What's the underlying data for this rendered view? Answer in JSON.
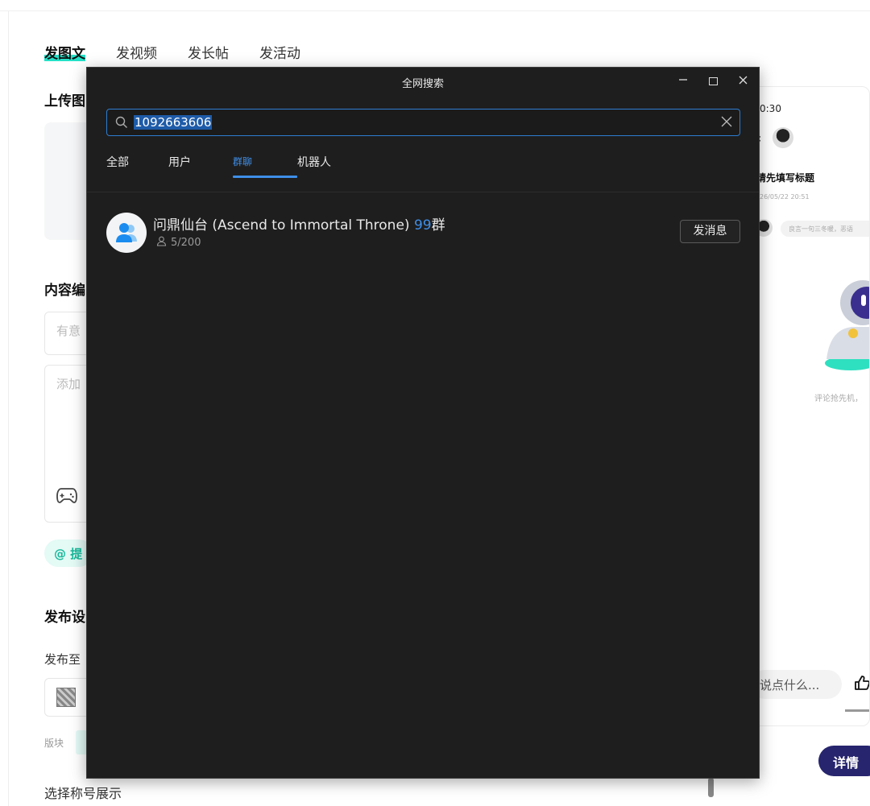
{
  "editor": {
    "tabs": [
      {
        "label": "发图文",
        "active": true
      },
      {
        "label": "发视频",
        "active": false
      },
      {
        "label": "发长帖",
        "active": false
      },
      {
        "label": "发活动",
        "active": false
      }
    ],
    "upload_title": "上传图",
    "content_title": "内容编",
    "title_placeholder": "有意",
    "body_placeholder": "添加",
    "mention_label": "@ 提",
    "publish_title": "发布设",
    "publish_to_label": "发布至",
    "board_label": "版块",
    "badge_label": "选择称号展示"
  },
  "preview": {
    "time": "0:30",
    "back_glyph": "‹",
    "post_title": "请先填写标题",
    "date": "26/05/22 20:51",
    "comment_snippet": "良言一句三冬暖，恶语",
    "empty_tip": "评论抢先机，",
    "say_placeholder": "说点什么...",
    "detail_label": "详情"
  },
  "dialog": {
    "title": "全网搜索",
    "search": {
      "value": "1092663606",
      "highlighted": true
    },
    "filter_tabs": [
      {
        "label": "全部",
        "active": false
      },
      {
        "label": "用户",
        "active": false
      },
      {
        "label": "群聊",
        "active": true
      },
      {
        "label": "机器人",
        "active": false
      }
    ],
    "results": [
      {
        "name_prefix": "问鼎仙台 (Ascend to Immortal Throne) ",
        "name_highlight": "99",
        "name_suffix": "群",
        "members": "5/200",
        "action_label": "发消息",
        "avatar_icon": "group-icon"
      }
    ]
  },
  "colors": {
    "dialog_bg": "#1e1e1e",
    "accent_blue": "#3f8fe8",
    "search_border": "#2e7dd1",
    "editor_accent": "#25e0c8",
    "detail_button": "#27256e"
  }
}
